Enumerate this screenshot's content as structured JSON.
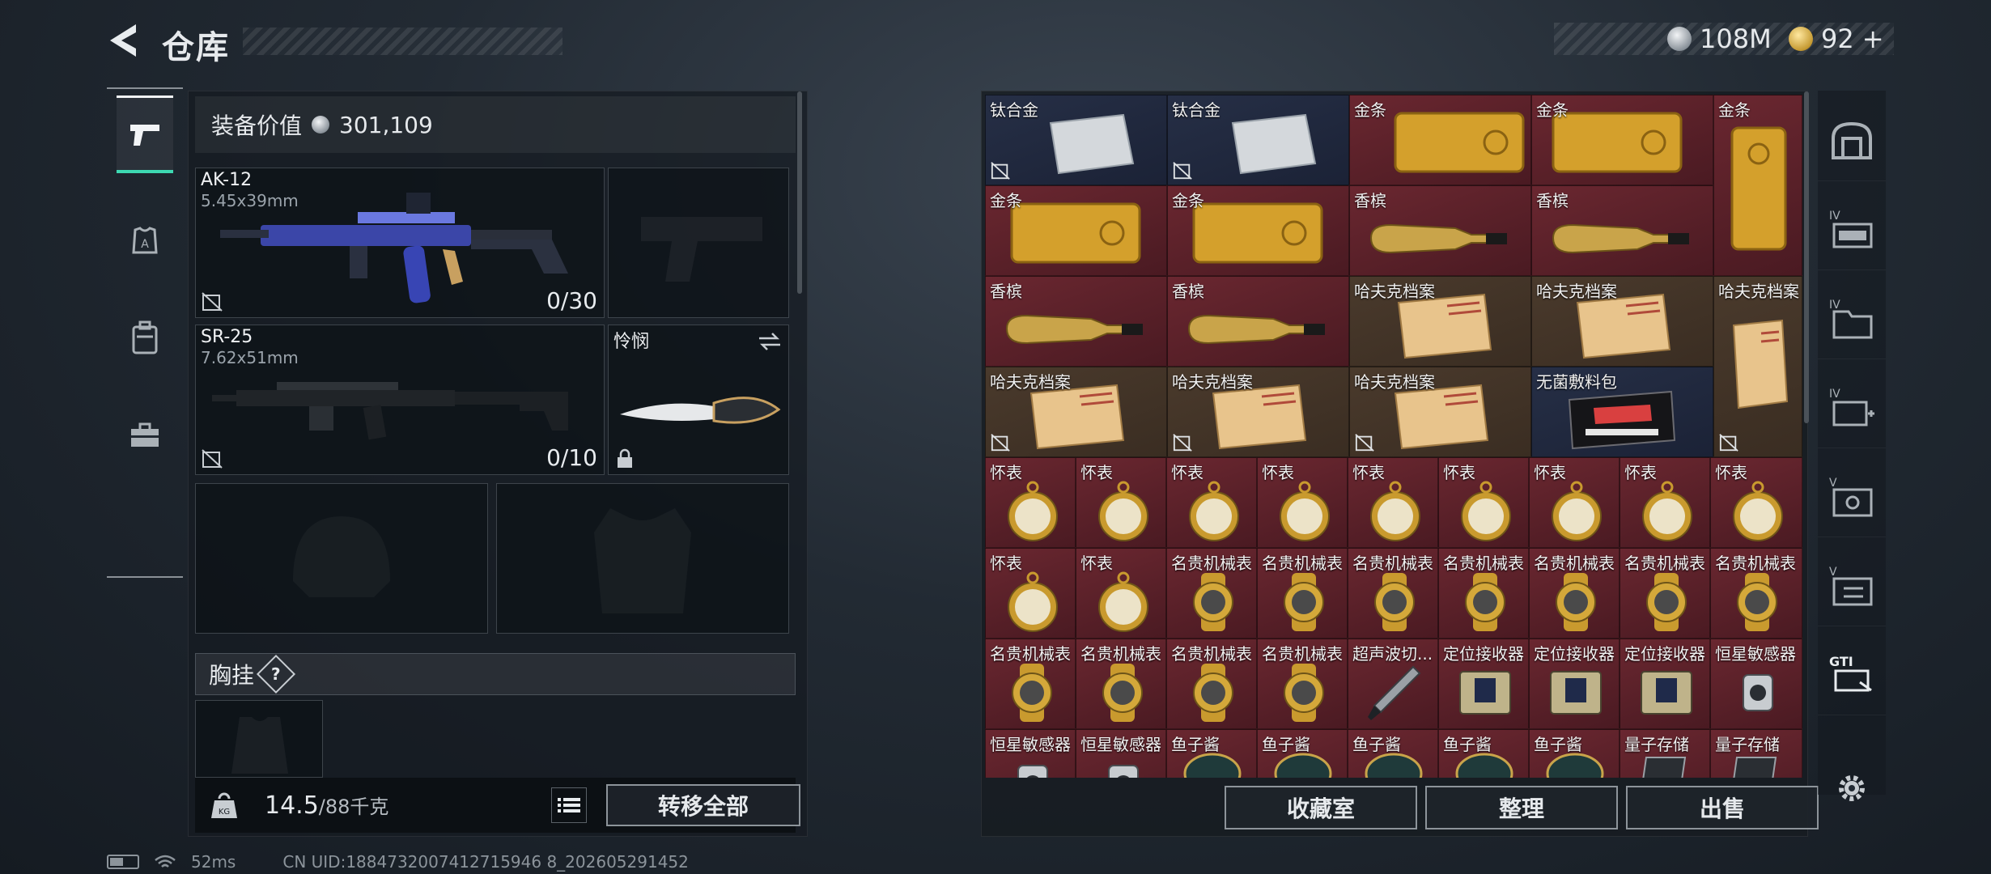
{
  "header": {
    "title": "仓库"
  },
  "currency": {
    "silver": "108M",
    "gold": "92",
    "gold_plus": "+"
  },
  "equipment": {
    "value_label": "装备价值",
    "value": "301,109",
    "slots": [
      {
        "name": "AK-12",
        "caliber": "5.45x39mm",
        "ammo": "0/30"
      },
      {
        "name": "SR-25",
        "caliber": "7.62x51mm",
        "ammo": "0/10"
      },
      {
        "name": "怜悯"
      }
    ],
    "chest_rig_label": "胸挂",
    "help": "?",
    "weight": "14.5",
    "weight_max": "/88千克",
    "transfer_all": "转移全部"
  },
  "stash": {
    "items": [
      {
        "label": "钛合金",
        "icon": "titanium-ingot-icon"
      },
      {
        "label": "钛合金",
        "icon": "titanium-ingot-icon"
      },
      {
        "label": "金条",
        "icon": "gold-bar-icon"
      },
      {
        "label": "金条",
        "icon": "gold-bar-icon"
      },
      {
        "label": "金条",
        "icon": "gold-bar-icon"
      },
      {
        "label": "金条",
        "icon": "gold-bar-icon"
      },
      {
        "label": "金条",
        "icon": "gold-bar-icon"
      },
      {
        "label": "香槟",
        "icon": "champagne-icon"
      },
      {
        "label": "香槟",
        "icon": "champagne-icon"
      },
      {
        "label": "香槟",
        "icon": "champagne-icon"
      },
      {
        "label": "香槟",
        "icon": "champagne-icon"
      },
      {
        "label": "哈夫克档案",
        "icon": "dossier-icon"
      },
      {
        "label": "哈夫克档案",
        "icon": "dossier-icon"
      },
      {
        "label": "哈夫克档案",
        "icon": "dossier-icon"
      },
      {
        "label": "哈夫克档案",
        "icon": "dossier-icon"
      },
      {
        "label": "哈夫克档案",
        "icon": "dossier-icon"
      },
      {
        "label": "哈夫克档案",
        "icon": "dossier-icon"
      },
      {
        "label": "无菌敷料包",
        "icon": "sterile-dressing-icon"
      },
      {
        "label": "怀表",
        "icon": "pocket-watch-icon"
      },
      {
        "label": "名贵机械表",
        "icon": "luxury-watch-icon"
      },
      {
        "label": "超声波切...",
        "icon": "ultrasonic-cutter-icon"
      },
      {
        "label": "定位接收器",
        "icon": "gps-receiver-icon"
      },
      {
        "label": "恒星敏感器",
        "icon": "star-sensor-icon"
      },
      {
        "label": "鱼子酱",
        "icon": "caviar-icon"
      },
      {
        "label": "量子存储",
        "icon": "quantum-storage-icon"
      }
    ]
  },
  "actions": {
    "collection": "收藏室",
    "sort": "整理",
    "sell": "出售"
  },
  "right_tabs": [
    "IV",
    "IV",
    "IV",
    "V",
    "V",
    "GTI"
  ],
  "status": {
    "ping": "52ms",
    "uid": "CN UID:1884732007412715946 8_202605291452"
  }
}
